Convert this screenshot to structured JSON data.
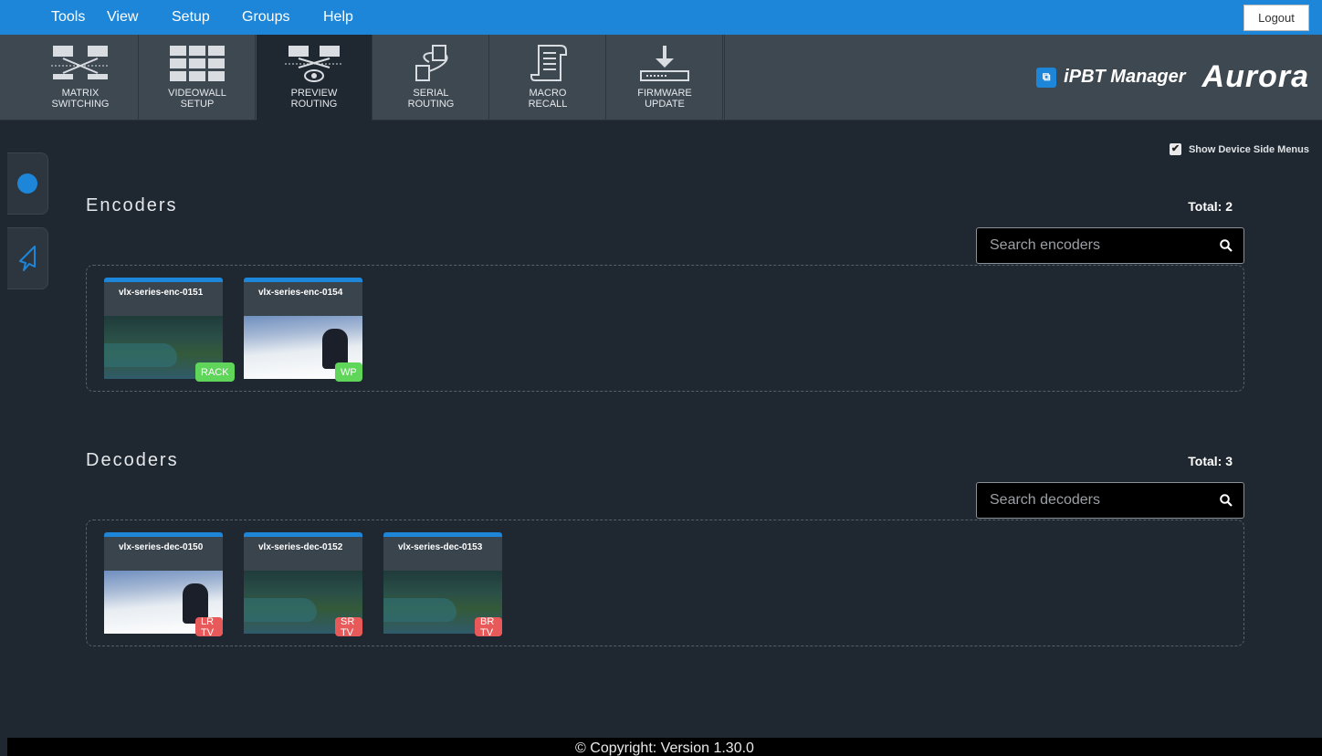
{
  "menu": [
    "Tools",
    "View",
    "Setup",
    "Groups",
    "Help"
  ],
  "logout_label": "Logout",
  "toolbar": [
    {
      "line1": "MATRIX",
      "line2": "SWITCHING",
      "icon": "matrix-switching-icon"
    },
    {
      "line1": "VIDEOWALL",
      "line2": "SETUP",
      "icon": "videowall-icon"
    },
    {
      "line1": "PREVIEW",
      "line2": "ROUTING",
      "icon": "preview-routing-icon",
      "active": true
    },
    {
      "line1": "SERIAL",
      "line2": "ROUTING",
      "icon": "serial-routing-icon"
    },
    {
      "line1": "MACRO",
      "line2": "RECALL",
      "icon": "macro-recall-icon"
    },
    {
      "line1": "FIRMWARE",
      "line2": "UPDATE",
      "icon": "firmware-update-icon"
    }
  ],
  "brand": {
    "product": "iPBT Manager",
    "company": "Aurora"
  },
  "show_side_menus": {
    "label": "Show Device Side Menus",
    "checked": true
  },
  "encoders": {
    "title": "Encoders",
    "total": "Total: 2",
    "search_placeholder": "Search encoders",
    "devices": [
      {
        "name": "vlx-series-enc-0151",
        "badge": "RACK",
        "thumb": "sea"
      },
      {
        "name": "vlx-series-enc-0154",
        "badge": "WP",
        "thumb": "snow"
      }
    ]
  },
  "decoders": {
    "title": "Decoders",
    "total": "Total: 3",
    "search_placeholder": "Search decoders",
    "devices": [
      {
        "name": "vlx-series-dec-0150",
        "badge": "LR TV",
        "thumb": "snow"
      },
      {
        "name": "vlx-series-dec-0152",
        "badge": "SR TV",
        "thumb": "sea"
      },
      {
        "name": "vlx-series-dec-0153",
        "badge": "BR TV",
        "thumb": "sea"
      }
    ]
  },
  "footer": "Copyright: Version 1.30.0",
  "colors": {
    "accent": "#1d86d8",
    "background": "#1f2730",
    "encoder_badge": "#5fd55a",
    "decoder_badge": "#e85a5a"
  }
}
